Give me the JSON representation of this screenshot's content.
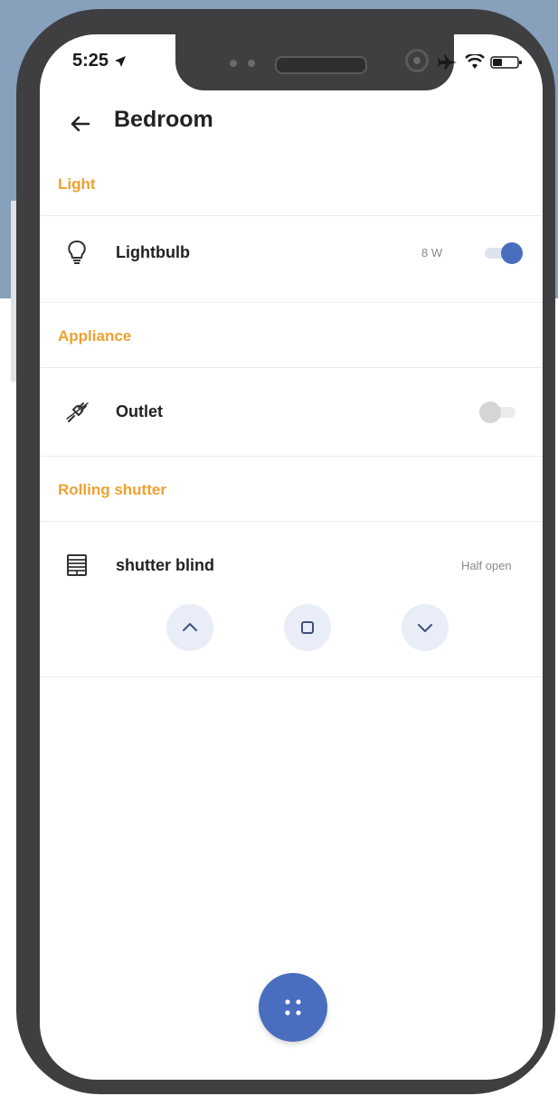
{
  "status_bar": {
    "time": "5:25"
  },
  "header": {
    "title": "Bedroom"
  },
  "sections": [
    {
      "title": "Light",
      "device": {
        "name": "Lightbulb",
        "power": "8 W",
        "toggle_on": true,
        "icon": "lightbulb-icon"
      }
    },
    {
      "title": "Appliance",
      "device": {
        "name": "Outlet",
        "toggle_on": false,
        "icon": "plug-icon"
      }
    },
    {
      "title": "Rolling shutter",
      "device": {
        "name": "shutter blind",
        "state": "Half open",
        "icon": "shutter-icon"
      }
    }
  ],
  "colors": {
    "accent": "#4a6ebf",
    "section_header": "#f0a030",
    "control_bg": "#e9edf7"
  }
}
